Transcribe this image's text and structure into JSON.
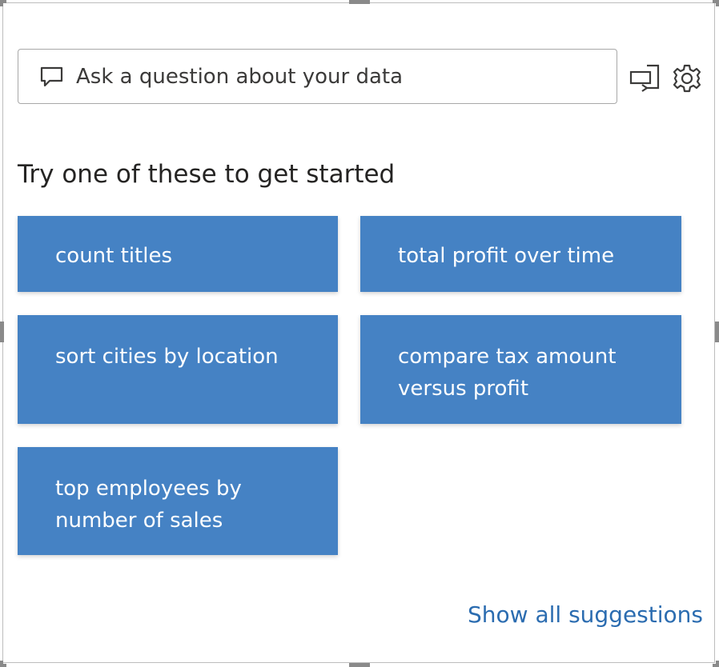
{
  "search": {
    "placeholder": "Ask a question about your data"
  },
  "toolbar": {
    "icons": [
      "chat-icon",
      "convert-visual-icon",
      "gear-icon"
    ]
  },
  "heading": "Try one of these to get started",
  "suggestions": [
    {
      "label": "count titles"
    },
    {
      "label": "total profit over time"
    },
    {
      "label": "sort cities by location"
    },
    {
      "label": "compare tax amount versus profit"
    },
    {
      "label": "top employees by number of sales"
    }
  ],
  "show_all": "Show all suggestions",
  "colors": {
    "accent": "#4582c4",
    "link": "#2b6cb0"
  }
}
